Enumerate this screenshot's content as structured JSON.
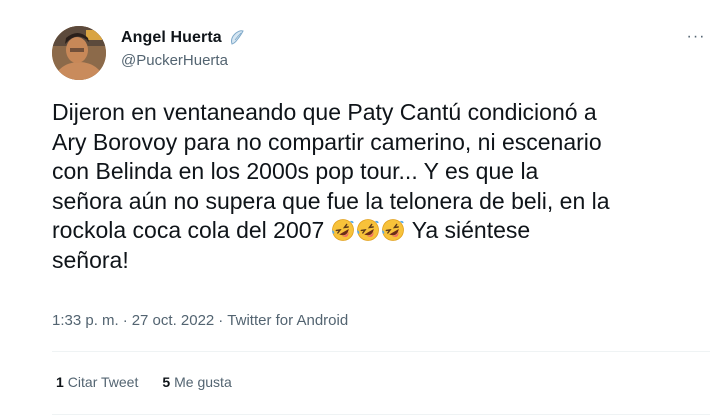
{
  "author": {
    "display_name": "Angel Huerta",
    "handle": "@PuckerHuerta",
    "badge_icon": "tortilla-emoji-icon"
  },
  "more_icon": "more-options-icon",
  "more_label": "···",
  "tweet": {
    "line1": "Dijeron en ventaneando que Paty Cantú condicionó a",
    "line2": "Ary Borovoy para no compartir camerino, ni escenario",
    "line3": "con Belinda en los 2000s pop tour... Y es que la",
    "line4": "señora aún no supera que fue la telonera de beli, en la",
    "line5_before": "rockola coca cola del 2007 ",
    "emoji_name": "rolling-on-floor-laughing-icon",
    "emoji_count": 3,
    "line5_after": " Ya siéntese",
    "line6": "señora!"
  },
  "meta": {
    "time": "1:33 p. m.",
    "sep1": "·",
    "date": "27 oct. 2022",
    "sep2": "·",
    "source": "Twitter for Android"
  },
  "stats": {
    "quotes_count": "1",
    "quotes_label": "Citar Tweet",
    "likes_count": "5",
    "likes_label": "Me gusta"
  },
  "colors": {
    "text": "#0f1419",
    "secondary": "#536471",
    "divider": "#eff3f4",
    "emoji_yellow": "#f7c23a",
    "tear_blue": "#5aa9e6"
  }
}
